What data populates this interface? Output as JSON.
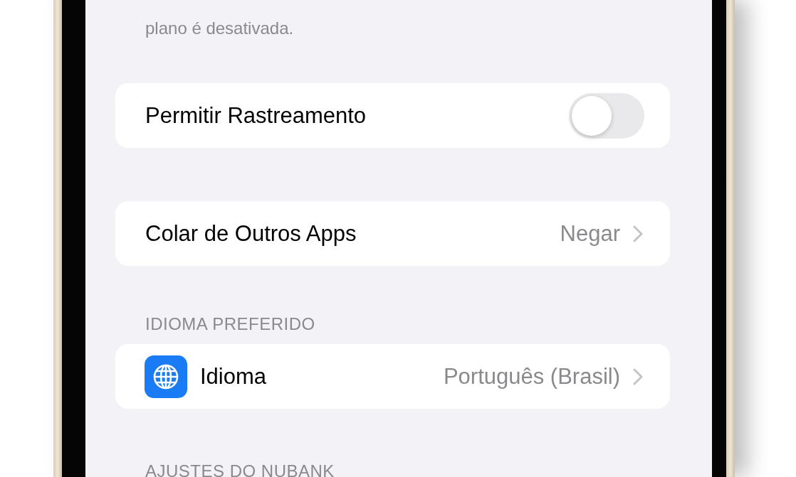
{
  "footer_note": "plano é desativada.",
  "tracking": {
    "label": "Permitir Rastreamento",
    "on": false
  },
  "paste": {
    "label": "Colar de Outros Apps",
    "value": "Negar"
  },
  "language_section": {
    "header": "IDIOMA PREFERIDO",
    "label": "Idioma",
    "value": "Português (Brasil)"
  },
  "next_section": {
    "header": "AJUSTES DO NUBANK"
  }
}
